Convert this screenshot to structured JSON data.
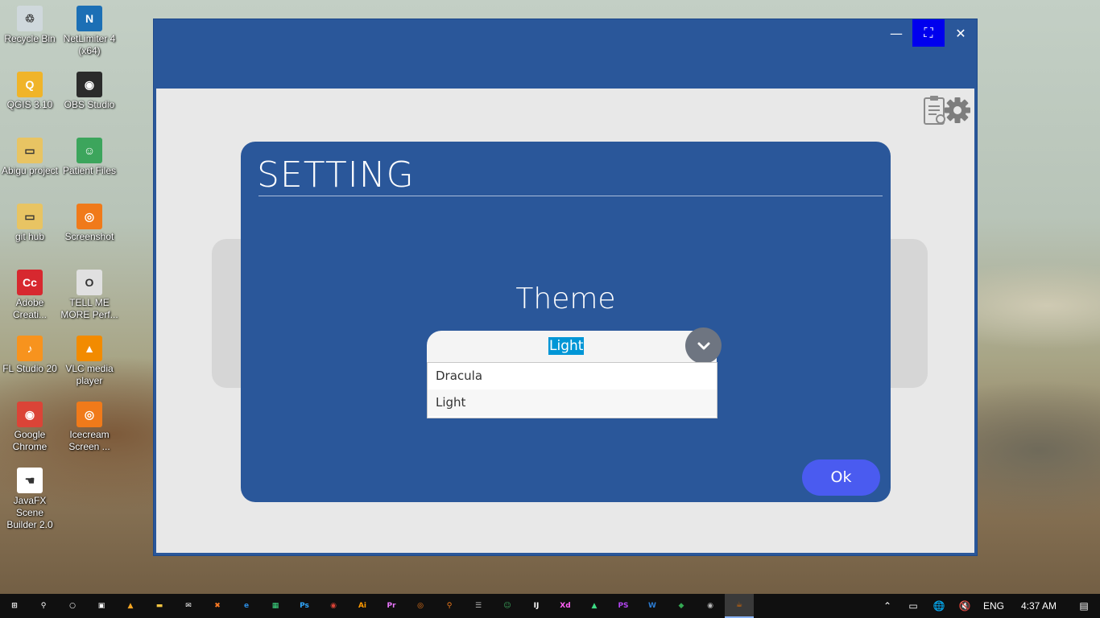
{
  "desktop": {
    "icons": [
      {
        "label": "Recycle Bin",
        "glyph": "♲",
        "color": "#cfd8dc"
      },
      {
        "label": "NetLimiter 4 (x64)",
        "glyph": "N",
        "color": "#1c6fb5"
      },
      {
        "label": "QGIS 3.10",
        "glyph": "Q",
        "color": "#f0b429"
      },
      {
        "label": "OBS Studio",
        "glyph": "◉",
        "color": "#2b2b2b"
      },
      {
        "label": "Abigu project",
        "glyph": "▭",
        "color": "#e8c463"
      },
      {
        "label": "Patient Files",
        "glyph": "☺",
        "color": "#3ca55c"
      },
      {
        "label": "git hub",
        "glyph": "▭",
        "color": "#e8c463"
      },
      {
        "label": "Screenshot",
        "glyph": "◎",
        "color": "#f07a1a"
      },
      {
        "label": "Adobe Creati...",
        "glyph": "Cc",
        "color": "#d7282f"
      },
      {
        "label": "TELL ME MORE Perf...",
        "glyph": "O",
        "color": "#e0e0e0"
      },
      {
        "label": "FL Studio 20",
        "glyph": "♪",
        "color": "#f7931e"
      },
      {
        "label": "VLC media player",
        "glyph": "▲",
        "color": "#f28b00"
      },
      {
        "label": "Google Chrome",
        "glyph": "◉",
        "color": "#db4437"
      },
      {
        "label": "Icecream Screen ...",
        "glyph": "◎",
        "color": "#f07a1a"
      },
      {
        "label": "JavaFX Scene Builder 2.0",
        "glyph": "☚",
        "color": "#ffffff"
      }
    ]
  },
  "window": {
    "controls": {
      "minimize": "—",
      "maximize": "⛶",
      "close": "✕"
    },
    "toolbar": {
      "clipboard_icon": "clipboard-icon",
      "settings_icon": "gear-icon"
    }
  },
  "dialog": {
    "title": "SETTING",
    "theme_label": "Theme",
    "theme_combo": {
      "selected": "Light",
      "options": [
        "Dracula",
        "Light"
      ]
    },
    "ok_label": "Ok"
  },
  "taskbar": {
    "apps": [
      {
        "name": "windows-start",
        "glyph": "⊞",
        "color": "#ffffff"
      },
      {
        "name": "search",
        "glyph": "⚲",
        "color": "#ffffff"
      },
      {
        "name": "cortana",
        "glyph": "○",
        "color": "#ffffff"
      },
      {
        "name": "task-view",
        "glyph": "▣",
        "color": "#ffffff"
      },
      {
        "name": "avast",
        "glyph": "▲",
        "color": "#f5a623"
      },
      {
        "name": "file-explorer",
        "glyph": "▬",
        "color": "#f4c542"
      },
      {
        "name": "mail",
        "glyph": "✉",
        "color": "#ffffff"
      },
      {
        "name": "xampp",
        "glyph": "✖",
        "color": "#fb7a24"
      },
      {
        "name": "edge",
        "glyph": "e",
        "color": "#2b8be0"
      },
      {
        "name": "android-studio",
        "glyph": "▦",
        "color": "#3ddc84"
      },
      {
        "name": "photoshop",
        "glyph": "Ps",
        "color": "#31a8ff"
      },
      {
        "name": "chrome",
        "glyph": "◉",
        "color": "#db4437"
      },
      {
        "name": "illustrator",
        "glyph": "Ai",
        "color": "#ff9a00"
      },
      {
        "name": "premiere",
        "glyph": "Pr",
        "color": "#ea77ff"
      },
      {
        "name": "screenshot",
        "glyph": "◎",
        "color": "#f07a1a"
      },
      {
        "name": "search-tool",
        "glyph": "⚲",
        "color": "#f07a1a"
      },
      {
        "name": "database",
        "glyph": "☰",
        "color": "#bbbbbb"
      },
      {
        "name": "patient",
        "glyph": "☺",
        "color": "#3ca55c"
      },
      {
        "name": "intellij",
        "glyph": "IJ",
        "color": "#ffffff"
      },
      {
        "name": "adobe-xd",
        "glyph": "Xd",
        "color": "#ff61f6"
      },
      {
        "name": "android",
        "glyph": "▲",
        "color": "#3ddc84"
      },
      {
        "name": "phpstorm",
        "glyph": "PS",
        "color": "#b345f1"
      },
      {
        "name": "word",
        "glyph": "W",
        "color": "#2b7cd3"
      },
      {
        "name": "maps",
        "glyph": "◆",
        "color": "#34a853"
      },
      {
        "name": "obs",
        "glyph": "◉",
        "color": "#bbbbbb"
      },
      {
        "name": "java",
        "glyph": "☕",
        "color": "#e76f00"
      }
    ],
    "tray": {
      "chevron": "⌃",
      "battery": "▭",
      "network": "🌐",
      "volume": "🔇",
      "language": "ENG",
      "time": "4:37 AM",
      "notifications": "▤"
    }
  }
}
